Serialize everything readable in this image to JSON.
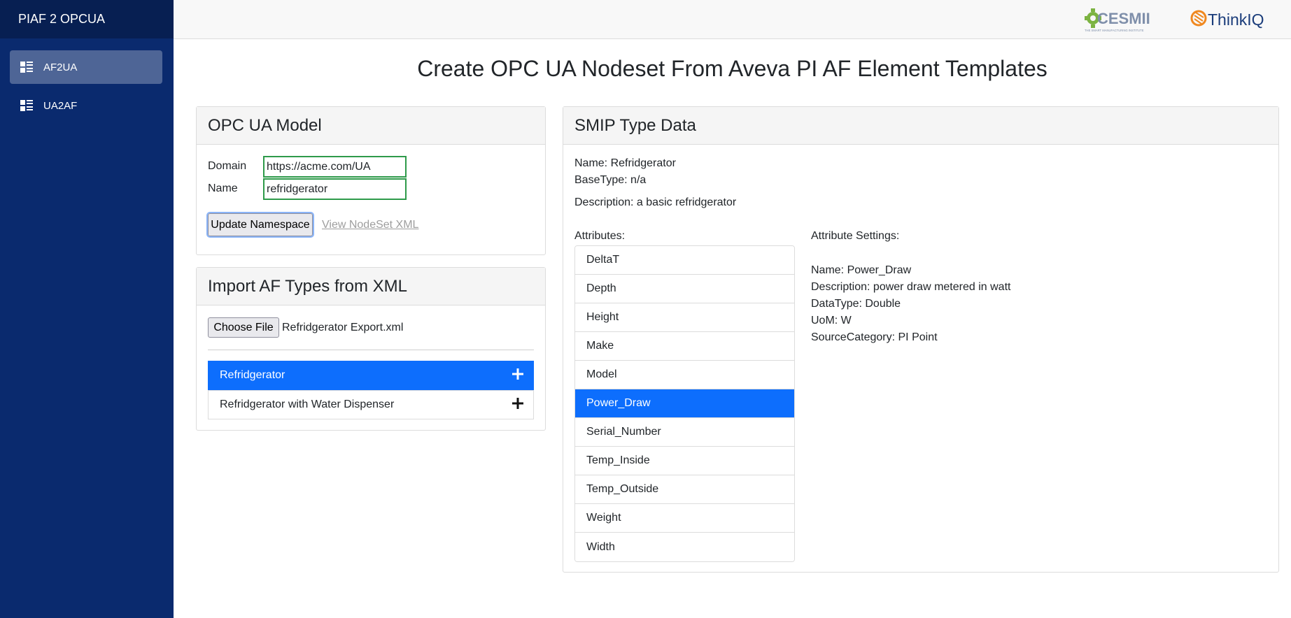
{
  "sidebar": {
    "brand": "PIAF 2 OPCUA",
    "items": [
      {
        "label": "AF2UA",
        "icon": "list-grid-icon",
        "active": true
      },
      {
        "label": "UA2AF",
        "icon": "list-grid-icon",
        "active": false
      }
    ]
  },
  "topbar": {
    "logos": [
      {
        "icon": "cesmii-logo",
        "text": "CESMII",
        "tagline": "THE SMART MANUFACTURING INSTITUTE"
      },
      {
        "icon": "thinkiq-logo",
        "text": "ThinkIQ"
      }
    ]
  },
  "page": {
    "title": "Create OPC UA Nodeset From Aveva PI AF Element Templates"
  },
  "opcua_model": {
    "title": "OPC UA Model",
    "domain_label": "Domain",
    "domain_value": "https://acme.com/UA",
    "name_label": "Name",
    "name_value": "refridgerator",
    "update_button": "Update Namespace",
    "view_link": "View NodeSet XML"
  },
  "import_af": {
    "title": "Import AF Types from XML",
    "choose_file_button": "Choose File",
    "file_name": "Refridgerator Export.xml",
    "types": [
      {
        "label": "Refridgerator",
        "active": true
      },
      {
        "label": "Refridgerator with Water Dispenser",
        "active": false
      }
    ]
  },
  "smip": {
    "title": "SMIP Type Data",
    "name_line": "Name: Refridgerator",
    "basetype_line": "BaseType: n/a",
    "description_line": "Description: a basic refridgerator",
    "attributes_label": "Attributes:",
    "attributes": [
      "DeltaT",
      "Depth",
      "Height",
      "Make",
      "Model",
      "Power_Draw",
      "Serial_Number",
      "Temp_Inside",
      "Temp_Outside",
      "Weight",
      "Width"
    ],
    "selected_attribute": "Power_Draw",
    "settings_label": "Attribute Settings:",
    "settings": {
      "name": "Name: Power_Draw",
      "description": "Description: power draw metered in watt",
      "datatype": "DataType: Double",
      "uom": "UoM: W",
      "source": "SourceCategory: PI Point"
    }
  },
  "colors": {
    "sidebar_bg": "#0a2a6e",
    "accent_blue": "#0d6efd",
    "input_border": "#2e9a4a"
  }
}
